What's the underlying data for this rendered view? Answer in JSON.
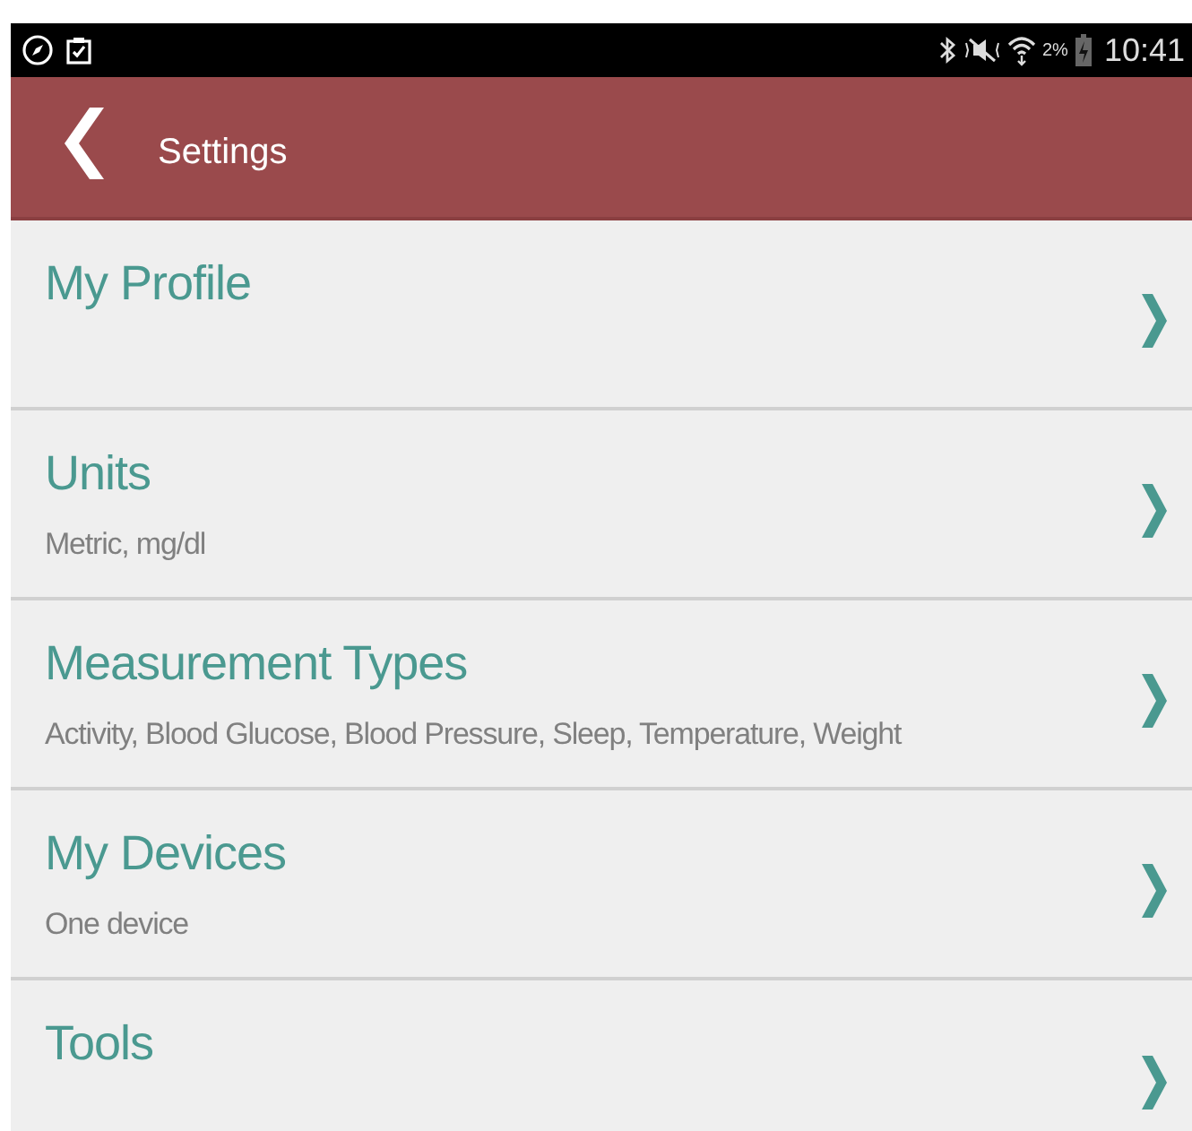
{
  "status_bar": {
    "battery_text": "2%",
    "time": "10:41"
  },
  "header": {
    "title": "Settings"
  },
  "items": [
    {
      "title": "My Profile"
    },
    {
      "title": "Units",
      "subtitle": "Metric, mg/dl"
    },
    {
      "title": "Measurement Types",
      "subtitle": "Activity, Blood Glucose, Blood Pressure, Sleep, Temperature, Weight"
    },
    {
      "title": "My Devices",
      "subtitle": "One device"
    },
    {
      "title": "Tools"
    }
  ]
}
